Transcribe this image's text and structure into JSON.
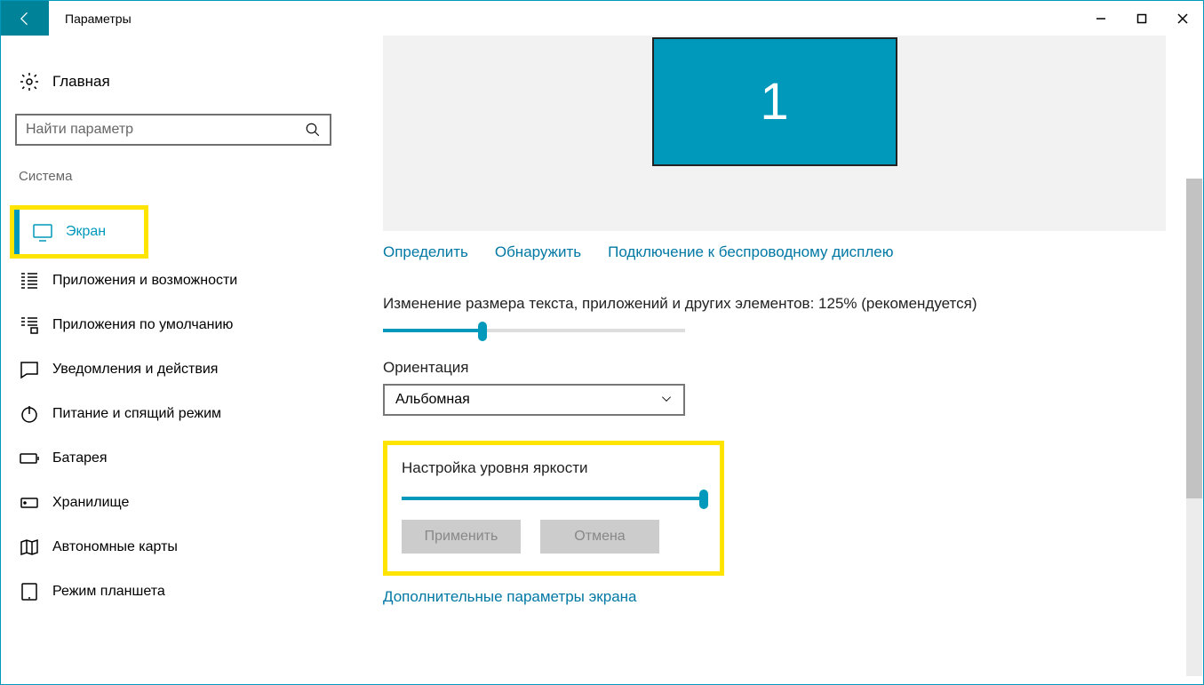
{
  "window": {
    "title": "Параметры"
  },
  "sidebar": {
    "home": "Главная",
    "search_placeholder": "Найти параметр",
    "section": "Система",
    "items": [
      {
        "label": "Экран",
        "active": true
      },
      {
        "label": "Приложения и возможности"
      },
      {
        "label": "Приложения по умолчанию"
      },
      {
        "label": "Уведомления и действия"
      },
      {
        "label": "Питание и спящий режим"
      },
      {
        "label": "Батарея"
      },
      {
        "label": "Хранилище"
      },
      {
        "label": "Автономные карты"
      },
      {
        "label": "Режим планшета"
      }
    ]
  },
  "main": {
    "monitor_number": "1",
    "links": {
      "identify": "Определить",
      "detect": "Обнаружить",
      "wireless": "Подключение к беспроводному дисплею"
    },
    "scale_label": "Изменение размера текста, приложений и других элементов: 125% (рекомендуется)",
    "scale_slider_percent": 33,
    "orientation_label": "Ориентация",
    "orientation_value": "Альбомная",
    "brightness_label": "Настройка уровня яркости",
    "brightness_slider_percent": 100,
    "apply_btn": "Применить",
    "cancel_btn": "Отмена",
    "advanced_link": "Дополнительные параметры экрана"
  }
}
